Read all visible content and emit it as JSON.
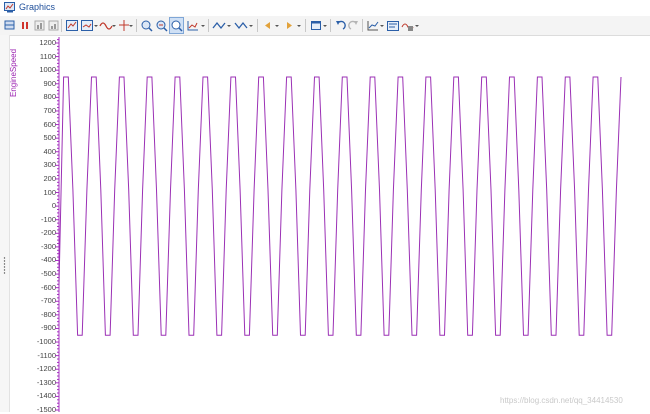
{
  "window": {
    "title": "Graphics"
  },
  "toolbar": {
    "buttons": [
      "grid-view-icon",
      "pause-icon",
      "bar-chart-icon",
      "bar-chart-2-icon",
      "chart-toggle-icon",
      "chart-display-icon",
      "wave-icon",
      "cursor-icon",
      "zoom-in-icon",
      "zoom-fit-icon",
      "zoom-window-icon",
      "axis-icon",
      "signal-up-icon",
      "signal-down-icon",
      "step-back-icon",
      "step-forward-icon",
      "layout-icon",
      "undo-icon",
      "redo-icon",
      "line-chart-icon",
      "properties-icon",
      "export-icon"
    ]
  },
  "chart_data": {
    "type": "line",
    "ylabel": "EngineSpeed",
    "ylim": [
      -1500,
      1250
    ],
    "yticks": [
      1200,
      1100,
      1000,
      900,
      800,
      700,
      600,
      500,
      400,
      300,
      200,
      100,
      0,
      -100,
      -200,
      -300,
      -400,
      -500,
      -600,
      -700,
      -800,
      -900,
      -1000,
      -1100,
      -1200,
      -1300,
      -1400,
      -1500
    ],
    "series": [
      {
        "color": "#9b30b5",
        "x": [
          0,
          1,
          2,
          3,
          4,
          5,
          6,
          7,
          8,
          9,
          10,
          11,
          12,
          13,
          14,
          15,
          16,
          17,
          18,
          19,
          20,
          21,
          22,
          23,
          24,
          25,
          26,
          27,
          28,
          29,
          30,
          31,
          32,
          33,
          34,
          35,
          36,
          37,
          38,
          39,
          40,
          41,
          42,
          43,
          44,
          45,
          46,
          47,
          48,
          49,
          50,
          51,
          52,
          53,
          54,
          55,
          56,
          57,
          58,
          59,
          60,
          61,
          62,
          63,
          64,
          65,
          66,
          67,
          68,
          69,
          70,
          71,
          72,
          73,
          74,
          75,
          76,
          77,
          78,
          79,
          80,
          81,
          82,
          83,
          84,
          85,
          86,
          87,
          88,
          89,
          90,
          91,
          92,
          93,
          94,
          95,
          96,
          97,
          98,
          99,
          100,
          101,
          102,
          103,
          104,
          105,
          106,
          107,
          108,
          109,
          110,
          111,
          112,
          113,
          114,
          115,
          116,
          117,
          118,
          119,
          120,
          121
        ],
        "values": [
          -580,
          950,
          950,
          120,
          -950,
          -950,
          120,
          950,
          950,
          120,
          -950,
          -950,
          120,
          950,
          950,
          120,
          -950,
          -950,
          120,
          950,
          950,
          120,
          -950,
          -950,
          120,
          950,
          950,
          120,
          -950,
          -950,
          120,
          950,
          950,
          120,
          -950,
          -950,
          120,
          950,
          950,
          120,
          -950,
          -950,
          120,
          950,
          950,
          120,
          -950,
          -950,
          120,
          950,
          950,
          120,
          -950,
          -950,
          120,
          950,
          950,
          120,
          -950,
          -950,
          120,
          950,
          950,
          120,
          -950,
          -950,
          120,
          950,
          950,
          120,
          -950,
          -950,
          120,
          950,
          950,
          120,
          -950,
          -950,
          120,
          950,
          950,
          120,
          -950,
          -950,
          120,
          950,
          950,
          120,
          -950,
          -950,
          120,
          950,
          950,
          120,
          -950,
          -950,
          120,
          950,
          950,
          120,
          -950,
          -950,
          120,
          950,
          950,
          120,
          -950,
          -950,
          120,
          950,
          950,
          120,
          -950,
          -950,
          120,
          950,
          950,
          120,
          -950,
          -950,
          120,
          950
        ]
      }
    ]
  },
  "watermark": "https://blog.csdn.net/qq_34414530"
}
